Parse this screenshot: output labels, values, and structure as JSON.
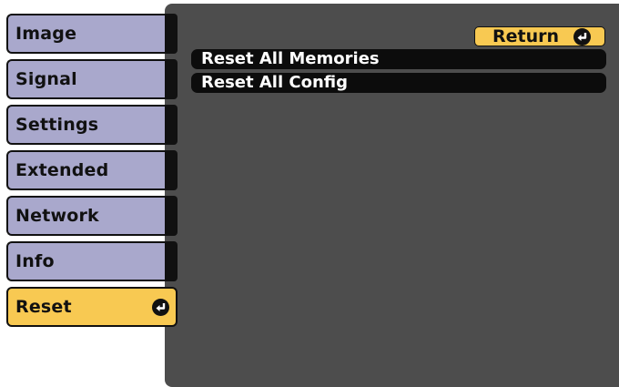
{
  "menu": {
    "items": [
      {
        "label": "Image"
      },
      {
        "label": "Signal"
      },
      {
        "label": "Settings"
      },
      {
        "label": "Extended"
      },
      {
        "label": "Network"
      },
      {
        "label": "Info"
      },
      {
        "label": "Reset",
        "selected": true,
        "icon": "enter-icon"
      }
    ]
  },
  "content": {
    "return_label": "Return",
    "return_icon": "enter-icon",
    "rows": [
      {
        "label": "Reset All Memories"
      },
      {
        "label": "Reset All Config"
      }
    ]
  },
  "colors": {
    "menu_item": "#a9a8cc",
    "selected": "#f8c952",
    "panel": "#4d4d4d",
    "row": "#0c0c0c"
  }
}
